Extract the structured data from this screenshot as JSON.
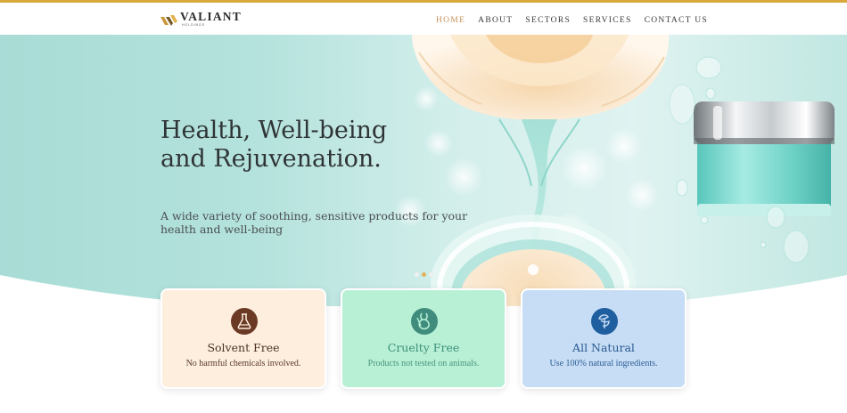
{
  "brand": {
    "name": "VALIANT",
    "sub": "HOLDINGS",
    "accent": "#d8a93a"
  },
  "nav": {
    "items": [
      {
        "label": "HOME",
        "active": true
      },
      {
        "label": "ABOUT"
      },
      {
        "label": "SECTORS"
      },
      {
        "label": "SERVICES"
      },
      {
        "label": "CONTACT US"
      }
    ],
    "active_color": "#c9925a"
  },
  "hero": {
    "title_line1": "Health, Well-being",
    "title_line2": "and Rejuvenation.",
    "subtitle": "A wide variety of soothing, sensitive products for your health and well-being",
    "slides": 3,
    "active_slide": 2
  },
  "features": [
    {
      "title": "Solvent Free",
      "text": "No harmful chemicals involved.",
      "icon": "flask-icon",
      "bg": "#fdeede",
      "icon_color": "#6b3a25"
    },
    {
      "title": "Cruelty Free",
      "text": "Products not tested on animals.",
      "icon": "rabbit-icon",
      "bg": "#b8f0d6",
      "icon_color": "#3f8c7d"
    },
    {
      "title": "All Natural",
      "text": "Use 100% natural ingredients.",
      "icon": "leaf-icon",
      "bg": "#c7ddf6",
      "icon_color": "#1f5fa0"
    }
  ]
}
